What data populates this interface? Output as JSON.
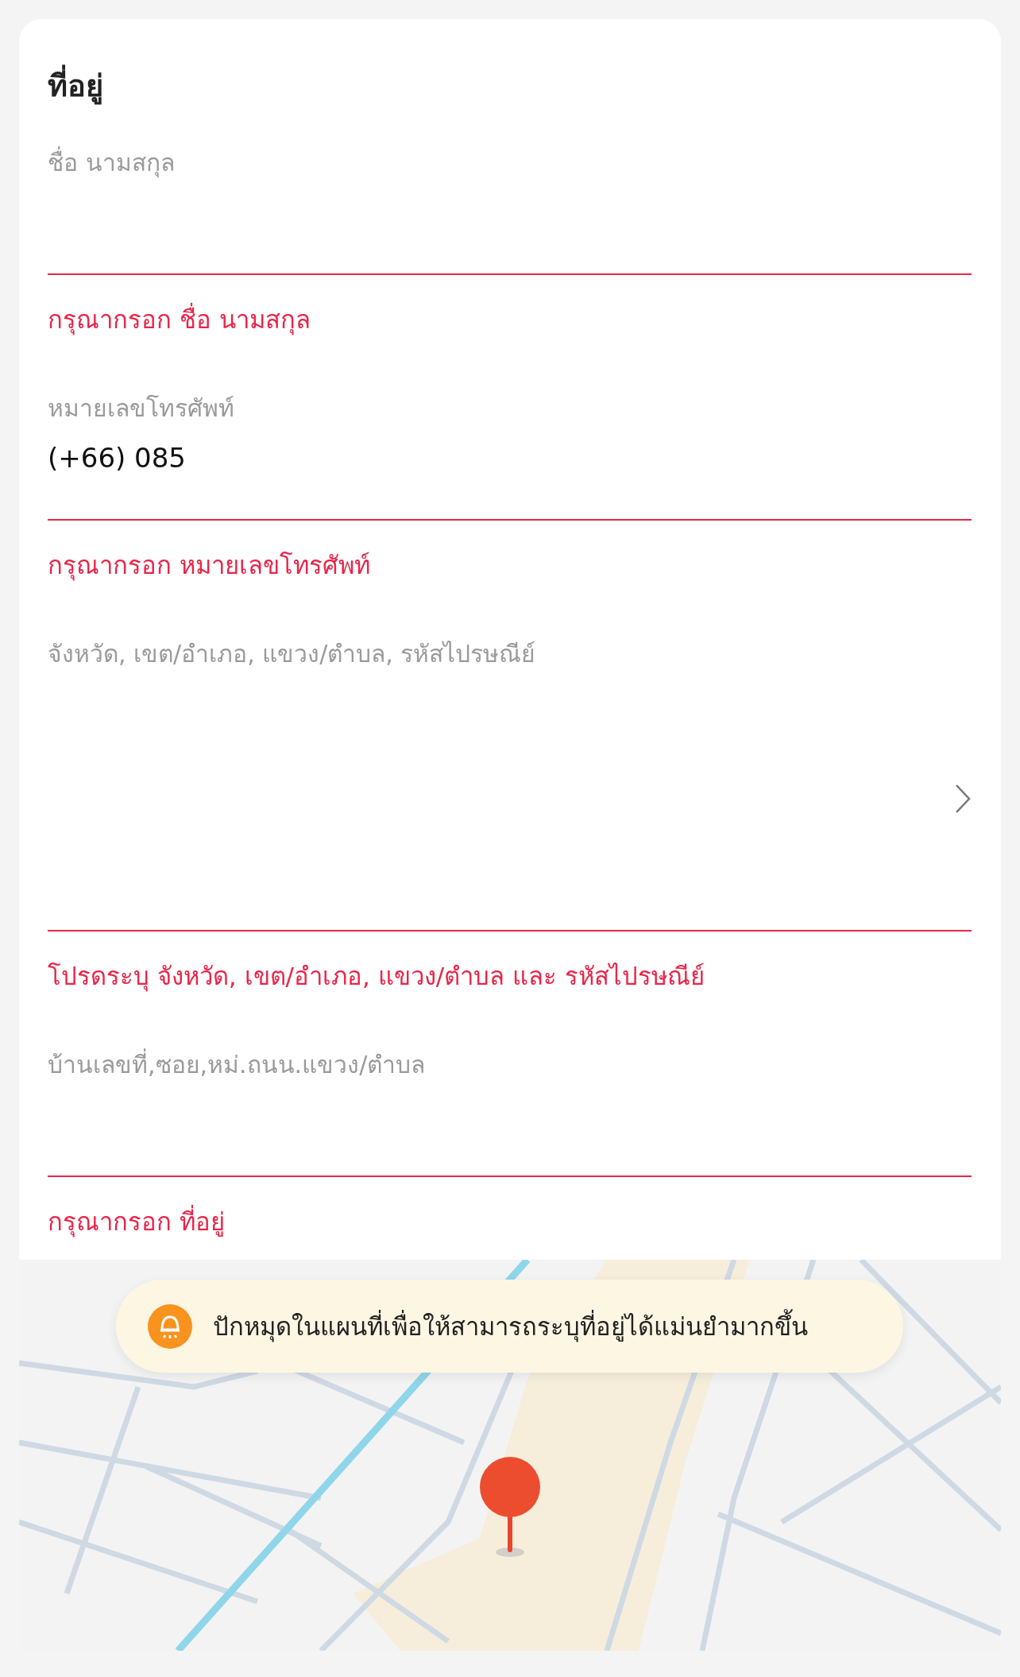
{
  "title": "ที่อยู่",
  "fields": [
    {
      "kind": "text",
      "label": "ชื่อ นามสกุล",
      "error": "กรุณากรอก ชื่อ นามสกุล"
    },
    {
      "kind": "text",
      "label": "หมายเลขโทรศัพท์",
      "value": "(+66) 085",
      "error": "กรุณากรอก หมายเลขโทรศัพท์"
    },
    {
      "kind": "select",
      "label": "จังหวัด, เขต/อำเภอ, แขวง/ตำบล, รหัสไปรษณีย์",
      "error": "โปรดระบุ จังหวัด, เขต/อำเภอ, แขวง/ตำบล และ รหัสไปรษณีย์"
    },
    {
      "kind": "text",
      "label": "บ้านเลขที่,ซอย,หม่.ถนน.แขวง/ตำบล",
      "error": "กรุณากรอก ที่อยู่"
    }
  ],
  "map": {
    "kind": "picture",
    "hint": "ปักหมุดในแผนที่เพื่อให้สามารถระบุที่อยู่ได้แม่นยำมากขึ้น"
  }
}
